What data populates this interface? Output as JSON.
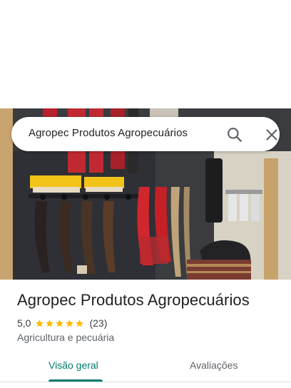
{
  "search": {
    "query": "Agropec Produtos Agropecuários"
  },
  "place": {
    "name": "Agropec Produtos Agropecuários",
    "rating": "5,0",
    "review_count": "(23)",
    "stars_filled": 5,
    "category": "Agricultura e pecuária"
  },
  "tabs": {
    "overview": "Visão geral",
    "reviews": "Avaliações"
  },
  "colors": {
    "accent": "#00796b",
    "star": "#fbbc04"
  },
  "icons": {
    "search": "search-icon",
    "close": "close-icon",
    "star": "star-icon"
  }
}
